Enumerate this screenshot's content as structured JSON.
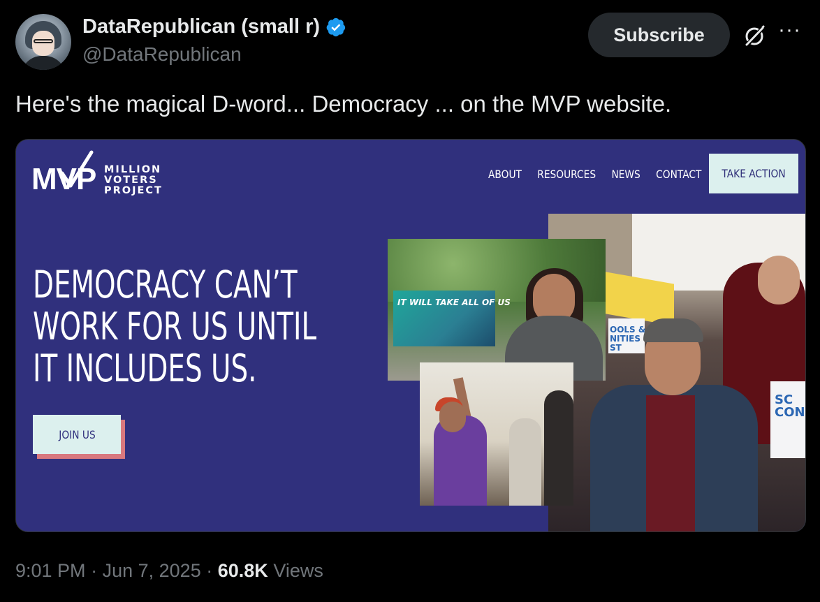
{
  "author": {
    "display_name": "DataRepublican (small r)",
    "handle": "@DataRepublican",
    "verified": true
  },
  "header_actions": {
    "subscribe_label": "Subscribe",
    "grok_icon": "grok-icon",
    "more_label": "···"
  },
  "tweet": {
    "text": "Here's the magical D-word... Democracy ... on the MVP website."
  },
  "embedded_site": {
    "logo": {
      "letters": "MVP",
      "line1": "MILLION",
      "line2": "VOTERS",
      "line3": "PROJECT"
    },
    "nav": [
      "ABOUT",
      "RESOURCES",
      "NEWS",
      "CONTACT"
    ],
    "cta_label": "TAKE ACTION",
    "headline_lines": [
      "DEMOCRACY CAN’T",
      "WORK FOR US UNTIL",
      "IT INCLUDES US."
    ],
    "join_label": "JOIN US",
    "photo_sign_text": "IT WILL TAKE ALL OF US",
    "photo_sign_right": "SC\nCON",
    "photo_sign_left": "OOLS &\nNITIES\nST",
    "colors": {
      "background": "#30307d",
      "button_bg": "#dcf0ee",
      "button_shadow": "#d8787e"
    }
  },
  "meta": {
    "time": "9:01 PM",
    "date": "Jun 7, 2025",
    "separator": "·",
    "views_count": "60.8K",
    "views_label": "Views"
  },
  "colors": {
    "page_bg": "#000000",
    "text_primary": "#e7e9ea",
    "text_secondary": "#71767b",
    "verified_blue": "#1d9bf0"
  }
}
